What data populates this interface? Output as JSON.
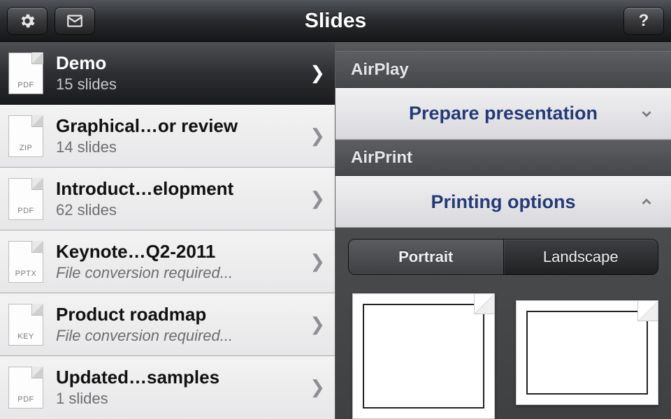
{
  "navbar": {
    "title": "Slides",
    "settings_icon": "gear",
    "compose_icon": "envelope",
    "help_icon": "help"
  },
  "list": {
    "items": [
      {
        "ext": "PDF",
        "title": "Demo",
        "sub": "15 slides",
        "sub_italic": false,
        "selected": true
      },
      {
        "ext": "ZIP",
        "title": "Graphical…or review",
        "sub": "14 slides",
        "sub_italic": false,
        "selected": false
      },
      {
        "ext": "PDF",
        "title": "Introduct…elopment",
        "sub": "62 slides",
        "sub_italic": false,
        "selected": false
      },
      {
        "ext": "PPTX",
        "title": "Keynote…Q2-2011",
        "sub": "File conversion required...",
        "sub_italic": true,
        "selected": false
      },
      {
        "ext": "KEY",
        "title": "Product roadmap",
        "sub": "File conversion required...",
        "sub_italic": true,
        "selected": false
      },
      {
        "ext": "PDF",
        "title": "Updated…samples",
        "sub": "1 slides",
        "sub_italic": false,
        "selected": false
      }
    ]
  },
  "panel": {
    "airplay_header": "AirPlay",
    "airplay_action": "Prepare presentation",
    "airprint_header": "AirPrint",
    "airprint_action": "Printing options",
    "orientation": {
      "portrait": "Portrait",
      "landscape": "Landscape",
      "active": "portrait"
    }
  }
}
